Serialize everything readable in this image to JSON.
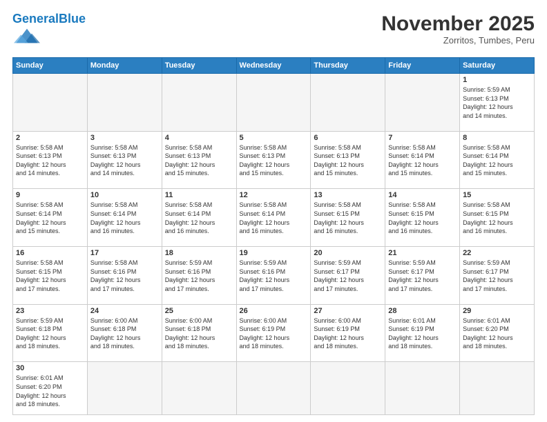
{
  "header": {
    "logo_general": "General",
    "logo_blue": "Blue",
    "month": "November 2025",
    "location": "Zorritos, Tumbes, Peru"
  },
  "days_of_week": [
    "Sunday",
    "Monday",
    "Tuesday",
    "Wednesday",
    "Thursday",
    "Friday",
    "Saturday"
  ],
  "weeks": [
    [
      {
        "day": "",
        "info": ""
      },
      {
        "day": "",
        "info": ""
      },
      {
        "day": "",
        "info": ""
      },
      {
        "day": "",
        "info": ""
      },
      {
        "day": "",
        "info": ""
      },
      {
        "day": "",
        "info": ""
      },
      {
        "day": "1",
        "info": "Sunrise: 5:59 AM\nSunset: 6:13 PM\nDaylight: 12 hours\nand 14 minutes."
      }
    ],
    [
      {
        "day": "2",
        "info": "Sunrise: 5:58 AM\nSunset: 6:13 PM\nDaylight: 12 hours\nand 14 minutes."
      },
      {
        "day": "3",
        "info": "Sunrise: 5:58 AM\nSunset: 6:13 PM\nDaylight: 12 hours\nand 14 minutes."
      },
      {
        "day": "4",
        "info": "Sunrise: 5:58 AM\nSunset: 6:13 PM\nDaylight: 12 hours\nand 15 minutes."
      },
      {
        "day": "5",
        "info": "Sunrise: 5:58 AM\nSunset: 6:13 PM\nDaylight: 12 hours\nand 15 minutes."
      },
      {
        "day": "6",
        "info": "Sunrise: 5:58 AM\nSunset: 6:13 PM\nDaylight: 12 hours\nand 15 minutes."
      },
      {
        "day": "7",
        "info": "Sunrise: 5:58 AM\nSunset: 6:14 PM\nDaylight: 12 hours\nand 15 minutes."
      },
      {
        "day": "8",
        "info": "Sunrise: 5:58 AM\nSunset: 6:14 PM\nDaylight: 12 hours\nand 15 minutes."
      }
    ],
    [
      {
        "day": "9",
        "info": "Sunrise: 5:58 AM\nSunset: 6:14 PM\nDaylight: 12 hours\nand 15 minutes."
      },
      {
        "day": "10",
        "info": "Sunrise: 5:58 AM\nSunset: 6:14 PM\nDaylight: 12 hours\nand 16 minutes."
      },
      {
        "day": "11",
        "info": "Sunrise: 5:58 AM\nSunset: 6:14 PM\nDaylight: 12 hours\nand 16 minutes."
      },
      {
        "day": "12",
        "info": "Sunrise: 5:58 AM\nSunset: 6:14 PM\nDaylight: 12 hours\nand 16 minutes."
      },
      {
        "day": "13",
        "info": "Sunrise: 5:58 AM\nSunset: 6:15 PM\nDaylight: 12 hours\nand 16 minutes."
      },
      {
        "day": "14",
        "info": "Sunrise: 5:58 AM\nSunset: 6:15 PM\nDaylight: 12 hours\nand 16 minutes."
      },
      {
        "day": "15",
        "info": "Sunrise: 5:58 AM\nSunset: 6:15 PM\nDaylight: 12 hours\nand 16 minutes."
      }
    ],
    [
      {
        "day": "16",
        "info": "Sunrise: 5:58 AM\nSunset: 6:15 PM\nDaylight: 12 hours\nand 17 minutes."
      },
      {
        "day": "17",
        "info": "Sunrise: 5:58 AM\nSunset: 6:16 PM\nDaylight: 12 hours\nand 17 minutes."
      },
      {
        "day": "18",
        "info": "Sunrise: 5:59 AM\nSunset: 6:16 PM\nDaylight: 12 hours\nand 17 minutes."
      },
      {
        "day": "19",
        "info": "Sunrise: 5:59 AM\nSunset: 6:16 PM\nDaylight: 12 hours\nand 17 minutes."
      },
      {
        "day": "20",
        "info": "Sunrise: 5:59 AM\nSunset: 6:17 PM\nDaylight: 12 hours\nand 17 minutes."
      },
      {
        "day": "21",
        "info": "Sunrise: 5:59 AM\nSunset: 6:17 PM\nDaylight: 12 hours\nand 17 minutes."
      },
      {
        "day": "22",
        "info": "Sunrise: 5:59 AM\nSunset: 6:17 PM\nDaylight: 12 hours\nand 17 minutes."
      }
    ],
    [
      {
        "day": "23",
        "info": "Sunrise: 5:59 AM\nSunset: 6:18 PM\nDaylight: 12 hours\nand 18 minutes."
      },
      {
        "day": "24",
        "info": "Sunrise: 6:00 AM\nSunset: 6:18 PM\nDaylight: 12 hours\nand 18 minutes."
      },
      {
        "day": "25",
        "info": "Sunrise: 6:00 AM\nSunset: 6:18 PM\nDaylight: 12 hours\nand 18 minutes."
      },
      {
        "day": "26",
        "info": "Sunrise: 6:00 AM\nSunset: 6:19 PM\nDaylight: 12 hours\nand 18 minutes."
      },
      {
        "day": "27",
        "info": "Sunrise: 6:00 AM\nSunset: 6:19 PM\nDaylight: 12 hours\nand 18 minutes."
      },
      {
        "day": "28",
        "info": "Sunrise: 6:01 AM\nSunset: 6:19 PM\nDaylight: 12 hours\nand 18 minutes."
      },
      {
        "day": "29",
        "info": "Sunrise: 6:01 AM\nSunset: 6:20 PM\nDaylight: 12 hours\nand 18 minutes."
      }
    ],
    [
      {
        "day": "30",
        "info": "Sunrise: 6:01 AM\nSunset: 6:20 PM\nDaylight: 12 hours\nand 18 minutes."
      },
      {
        "day": "",
        "info": ""
      },
      {
        "day": "",
        "info": ""
      },
      {
        "day": "",
        "info": ""
      },
      {
        "day": "",
        "info": ""
      },
      {
        "day": "",
        "info": ""
      },
      {
        "day": "",
        "info": ""
      }
    ]
  ]
}
